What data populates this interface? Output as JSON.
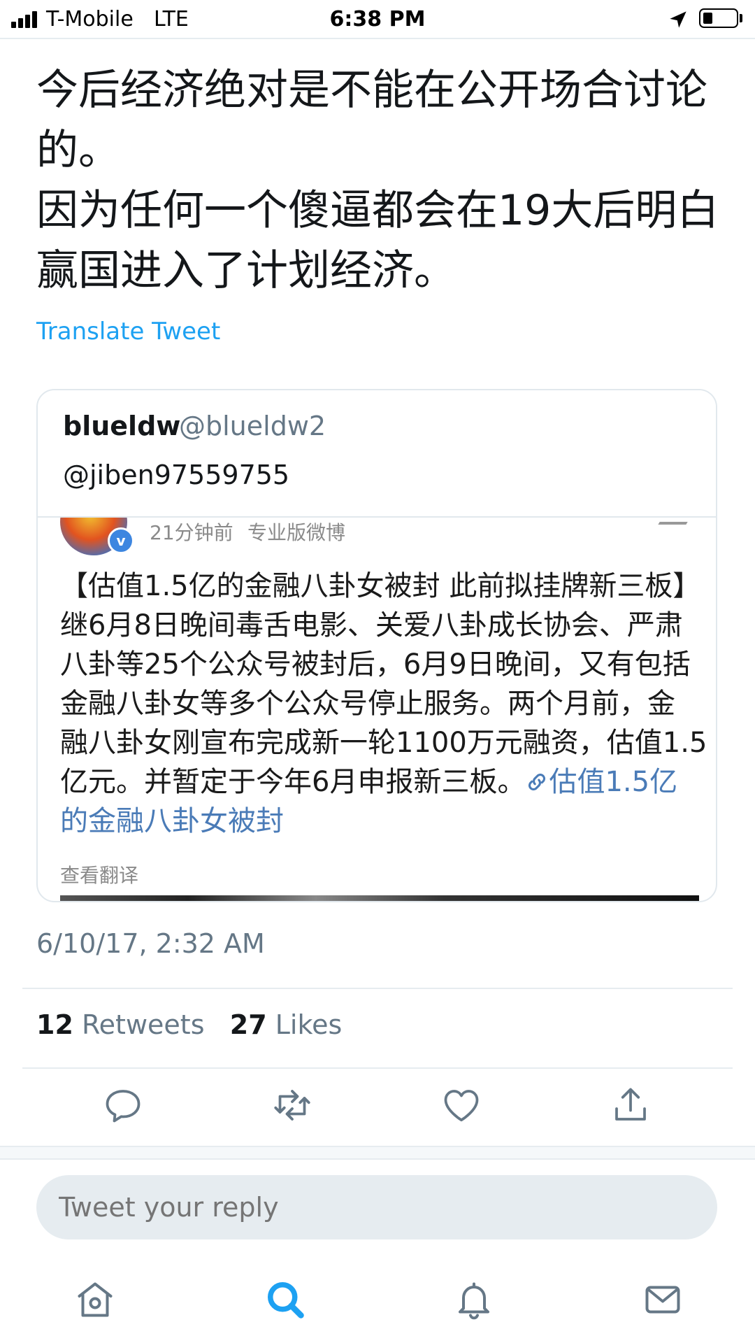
{
  "status_bar": {
    "carrier": "T-Mobile",
    "network": "LTE",
    "time": "6:38 PM",
    "signal_bars": 4,
    "battery_level": 0.3
  },
  "tweet": {
    "text_lines": [
      "今后经济绝对是不能在公开场合讨论",
      "的。",
      "因为任何一个傻逼都会在19大后明白",
      "赢国进入了计划经济。"
    ],
    "translate_label": "Translate Tweet",
    "timestamp": "6/10/17, 2:32 AM"
  },
  "quoted_tweet": {
    "name": "blueldw",
    "handle": "@blueldw2",
    "reply_to": "@jiben97559755",
    "screenshot": {
      "time_ago": "21分钟前",
      "source": "专业版微博",
      "verified_mark": "v",
      "body_lines": [
        "【估值1.5亿的金融八卦女被封 此前拟挂牌新三板】",
        "继6月8日晚间毒舌电影、关爱八卦成长协会、严肃",
        "八卦等25个公众号被封后，6月9日晚间，又有包括",
        "金融八卦女等多个公众号停止服务。两个月前，金",
        "融八卦女刚宣布完成新一轮1100万元融资，估值1.5",
        "亿元。并暂定于今年6月申报新三板。"
      ],
      "link_part1": "估值1.5亿",
      "link_part2": "的金融八卦女被封",
      "see_translation": "查看翻译"
    }
  },
  "stats": {
    "retweets_count": "12",
    "retweets_label": "Retweets",
    "likes_count": "27",
    "likes_label": "Likes"
  },
  "actions": [
    "reply-icon",
    "retweet-icon",
    "like-icon",
    "share-icon"
  ],
  "reply_box": {
    "placeholder": "Tweet your reply"
  },
  "tab_bar": [
    "home-icon",
    "search-icon",
    "notifications-icon",
    "messages-icon"
  ],
  "colors": {
    "accent": "#1da1f2",
    "icon_gray": "#657786",
    "link": "#4a7bb7"
  }
}
